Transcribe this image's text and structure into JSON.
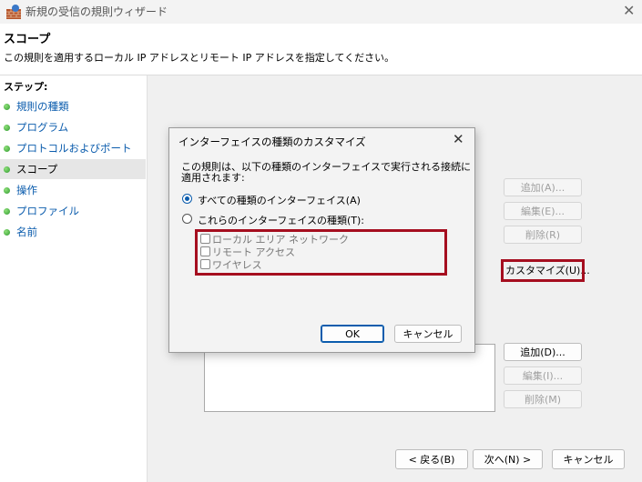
{
  "window": {
    "title": "新規の受信の規則ウィザード"
  },
  "header": {
    "title": "スコープ",
    "description": "この規則を適用するローカル IP アドレスとリモート IP アドレスを指定してください。"
  },
  "sidebar": {
    "steps_label": "ステップ:",
    "items": [
      {
        "label": "規則の種類"
      },
      {
        "label": "プログラム"
      },
      {
        "label": "プロトコルおよびポート"
      },
      {
        "label": "スコープ"
      },
      {
        "label": "操作"
      },
      {
        "label": "プロファイル"
      },
      {
        "label": "名前"
      }
    ],
    "active_index": 3
  },
  "main": {
    "local_buttons": {
      "add": "追加(A)...",
      "edit": "編集(E)...",
      "remove": "削除(R)"
    },
    "customize_button": "カスタマイズ(U)...",
    "remote_buttons": {
      "add": "追加(D)...",
      "edit": "編集(I)...",
      "remove": "削除(M)"
    },
    "footer": {
      "back": "< 戻る(B)",
      "next": "次へ(N) >",
      "cancel": "キャンセル"
    }
  },
  "dialog": {
    "title": "インターフェイスの種類のカスタマイズ",
    "description": "この規則は、以下の種類のインターフェイスで実行される接続に適用されます:",
    "option_all": "すべての種類のインターフェイス(A)",
    "option_these": "これらのインターフェイスの種類(T):",
    "selected_option": "all",
    "interfaces": [
      {
        "label": "ローカル エリア ネットワーク",
        "checked": false
      },
      {
        "label": "リモート アクセス",
        "checked": false
      },
      {
        "label": "ワイヤレス",
        "checked": false
      }
    ],
    "ok": "OK",
    "cancel": "キャンセル"
  },
  "colors": {
    "highlight": "#a50e1f",
    "accent": "#0b5cad",
    "step_link": "#0b5cad"
  }
}
